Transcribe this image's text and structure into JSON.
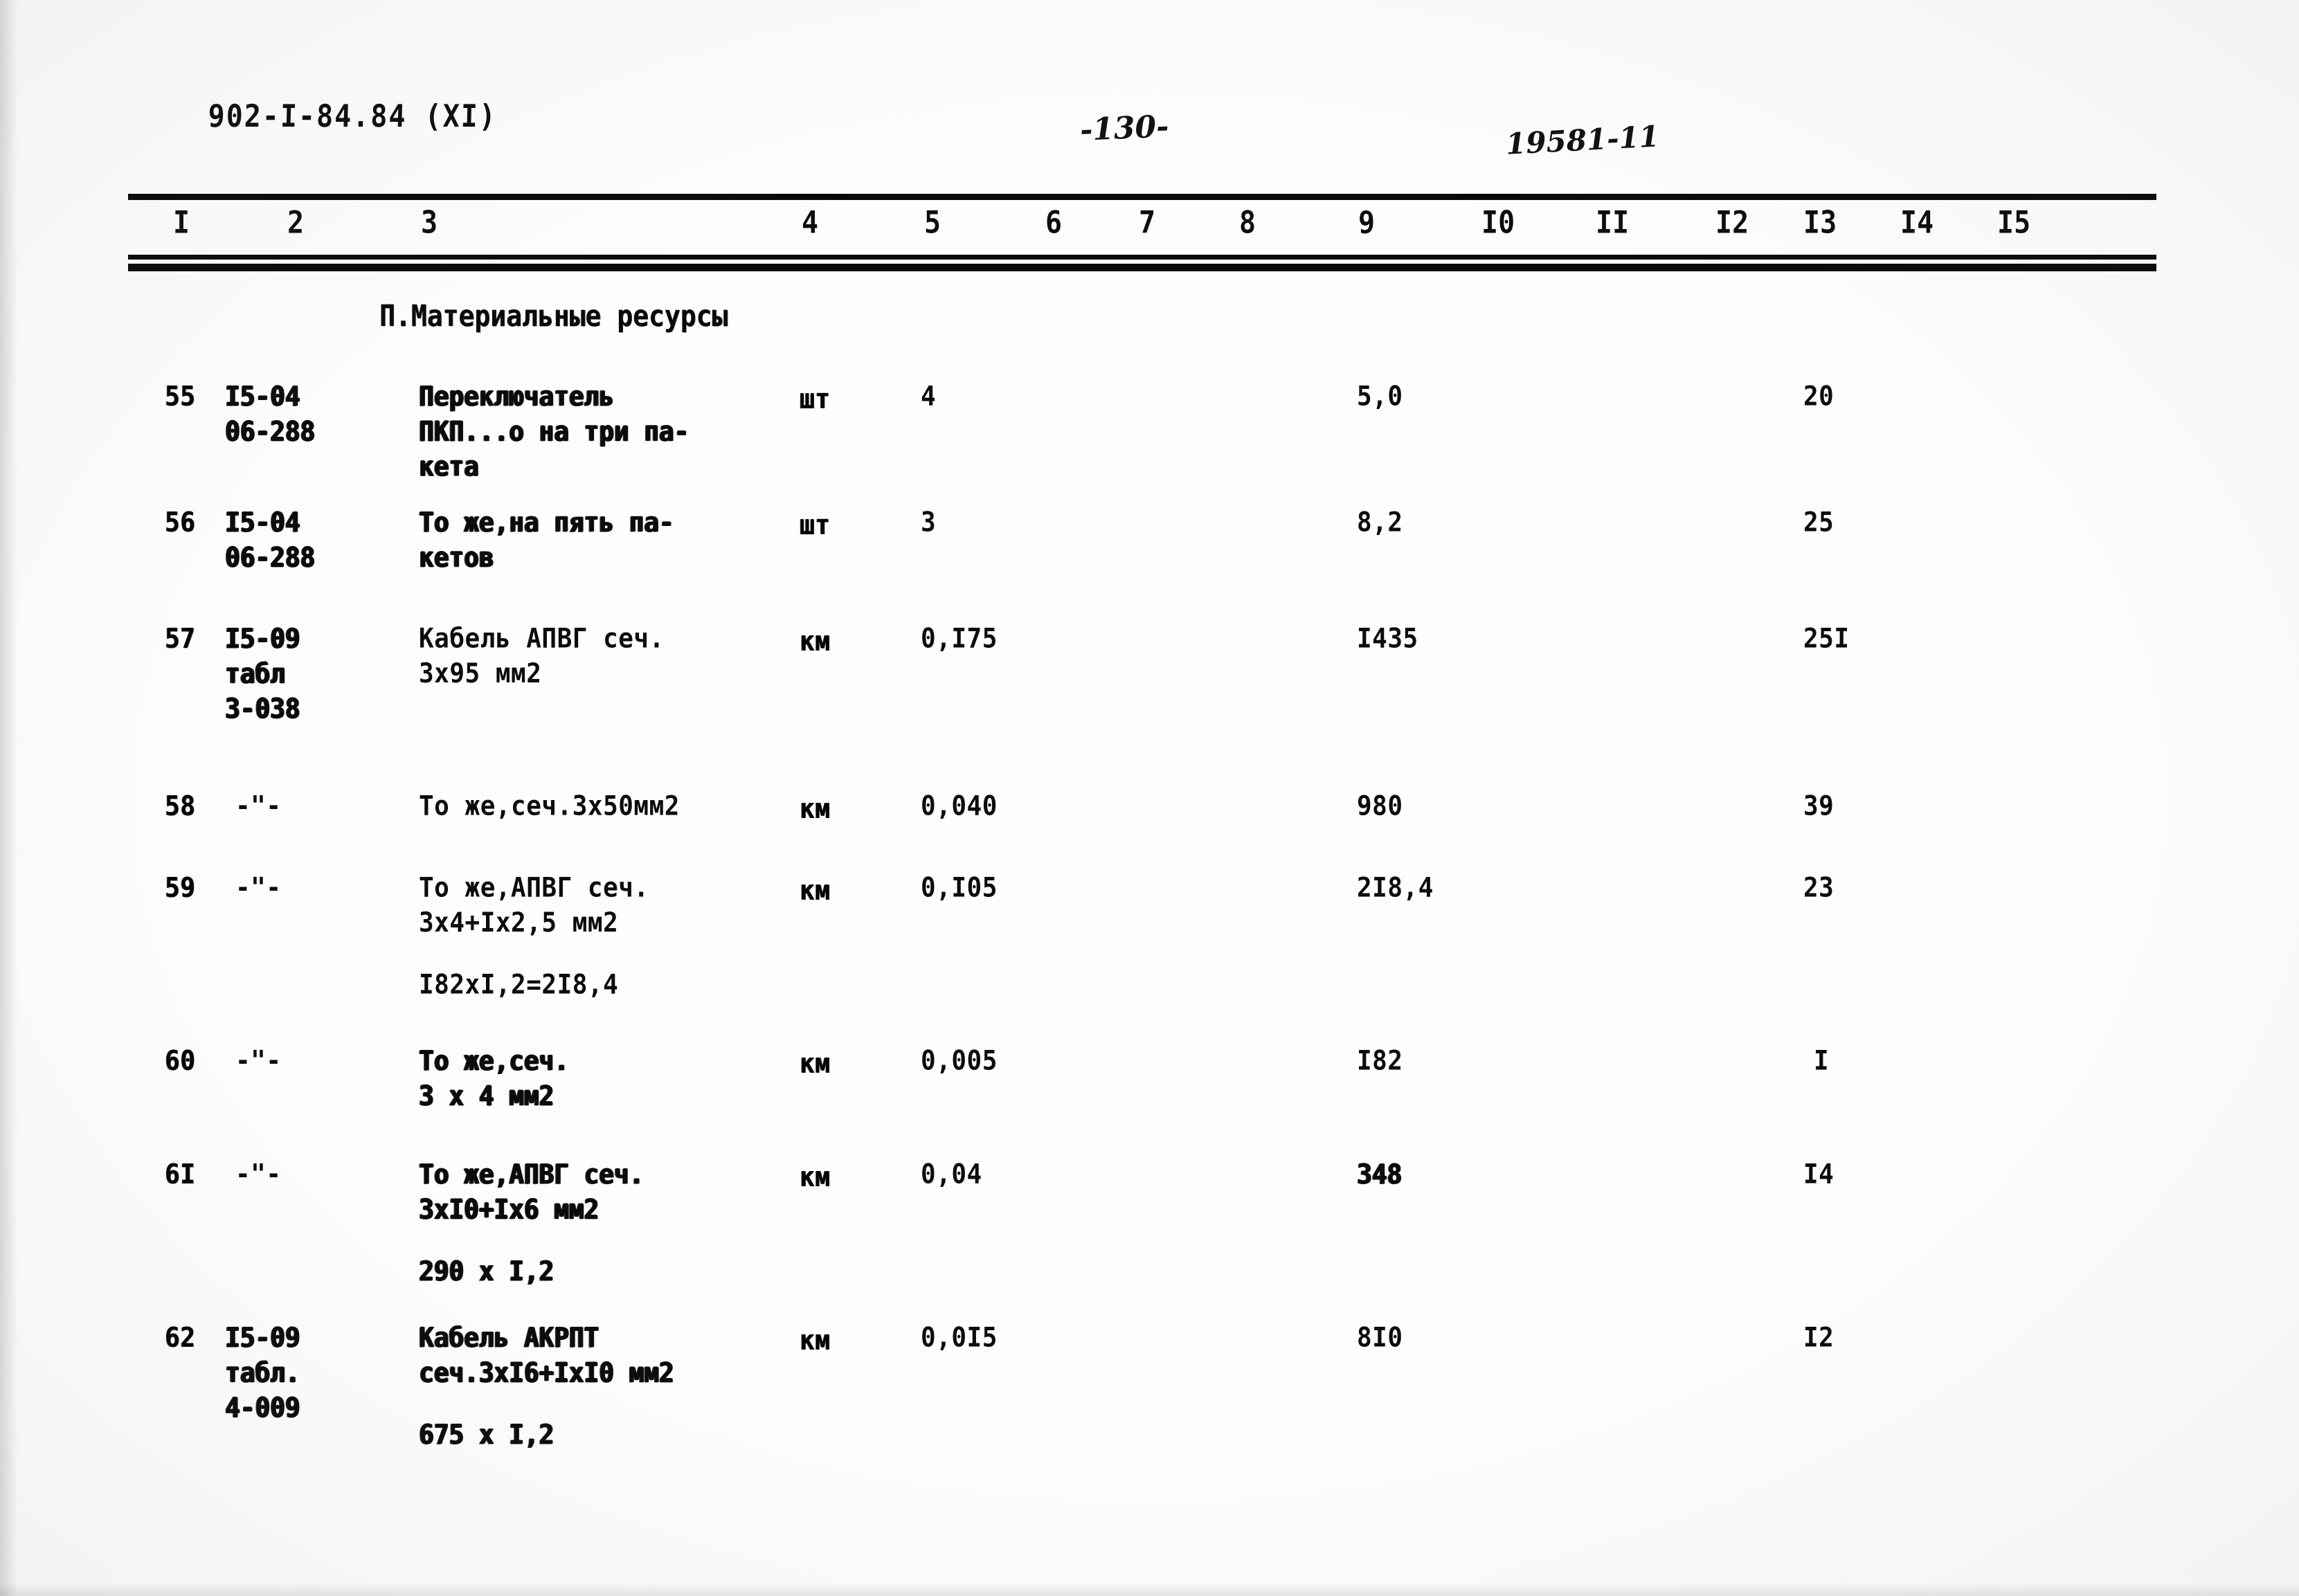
{
  "header": {
    "doc_code": "902-I-84.84 (XI)",
    "page_number": "-130-",
    "archive_number": "19581-11"
  },
  "table": {
    "column_headers": [
      "I",
      "2",
      "3",
      "4",
      "5",
      "6",
      "7",
      "8",
      "9",
      "I0",
      "II",
      "I2",
      "I3",
      "I4",
      "I5"
    ],
    "section_title": "П.Материальные ресурсы",
    "rows": [
      {
        "num": "55",
        "code": "I5-04\n06-288",
        "name": "Переключатель\nПКП...о на три па-\nкета",
        "unit": "шт",
        "col5": "4",
        "col9": "5,0",
        "col13": "20"
      },
      {
        "num": "56",
        "code": "I5-04\n06-288",
        "name": "То же,на пять па-\nкетов",
        "unit": "шт",
        "col5": "3",
        "col9": "8,2",
        "col13": "25"
      },
      {
        "num": "57",
        "code": "I5-09\nтабл\n3-038",
        "name": "Кабель АПВГ сеч.\n3х95 мм2",
        "unit": "км",
        "col5": "0,I75",
        "col9": "I435",
        "col13": "25I"
      },
      {
        "num": "58",
        "code": "-\"-",
        "name": "То же,сеч.3х50мм2",
        "unit": "км",
        "col5": "0,040",
        "col9": "980",
        "col13": "39"
      },
      {
        "num": "59",
        "code": "-\"-",
        "name": "То же,АПВГ сеч.\n3х4+Iх2,5 мм2",
        "formula": "I82хI,2=2I8,4",
        "unit": "км",
        "col5": "0,I05",
        "col9": "2I8,4",
        "col13": "23"
      },
      {
        "num": "60",
        "code": "-\"-",
        "name": "То же,сеч.\n3 х 4 мм2",
        "unit": "км",
        "col5": "0,005",
        "col9": "I82",
        "col13": "I"
      },
      {
        "num": "6I",
        "code": "-\"-",
        "name": "То же,АПВГ сеч.\n3хI0+Iх6 мм2",
        "formula": "290 х I,2",
        "unit": "км",
        "col5": "0,04",
        "col9": "348",
        "col13": "I4"
      },
      {
        "num": "62",
        "code": "I5-09\nтабл.\n4-009",
        "name": "Кабель АКРПТ\nсеч.3хI6+IхI0 мм2",
        "formula": "675 х I,2",
        "unit": "км",
        "col5": "0,0I5",
        "col9": "8I0",
        "col13": "I2"
      }
    ]
  }
}
